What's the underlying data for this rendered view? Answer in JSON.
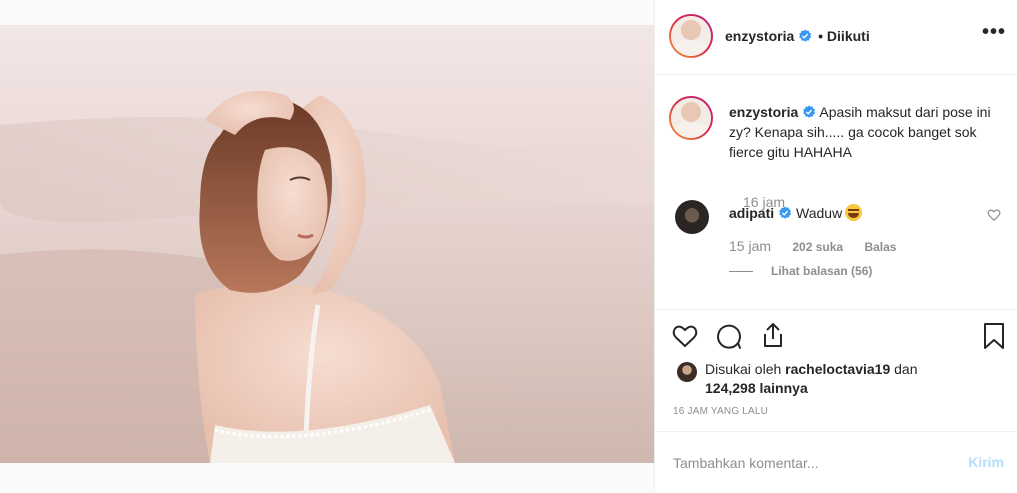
{
  "post": {
    "author": "enzystoria",
    "follow_status": "• Diikuti",
    "more_icon": "more-horizontal-icon",
    "photo_alt_icon": "photo-image",
    "caption": {
      "username": "enzystoria",
      "text": "Apasih maksut dari pose ini zy? Kenapa sih..... ga cocok banget sok fierce gitu HAHAHA",
      "time": "16 jam"
    },
    "comments": [
      {
        "username": "adipati",
        "text": "Waduw",
        "emoji": "grinning-sweat-emoji",
        "time": "15 jam",
        "likes": "202 suka",
        "reply_label": "Balas",
        "view_replies": "Lihat balasan (56)"
      }
    ],
    "actions": {
      "like_icon": "heart-icon",
      "comment_icon": "comment-icon",
      "share_icon": "share-icon",
      "save_icon": "bookmark-icon"
    },
    "liked_by": {
      "prefix": "Disukai oleh",
      "user": "racheloctavia19",
      "connector": "dan",
      "others": "124,298 lainnya"
    },
    "timestamp": "16 JAM YANG LALU",
    "add_comment": {
      "placeholder": "Tambahkan komentar...",
      "post_label": "Kirim"
    },
    "colors": {
      "verified": "#3897f0",
      "muted": "#8e8e8e",
      "text": "#262626",
      "post_button_disabled": "#b2dffc",
      "border": "#efefef"
    }
  }
}
